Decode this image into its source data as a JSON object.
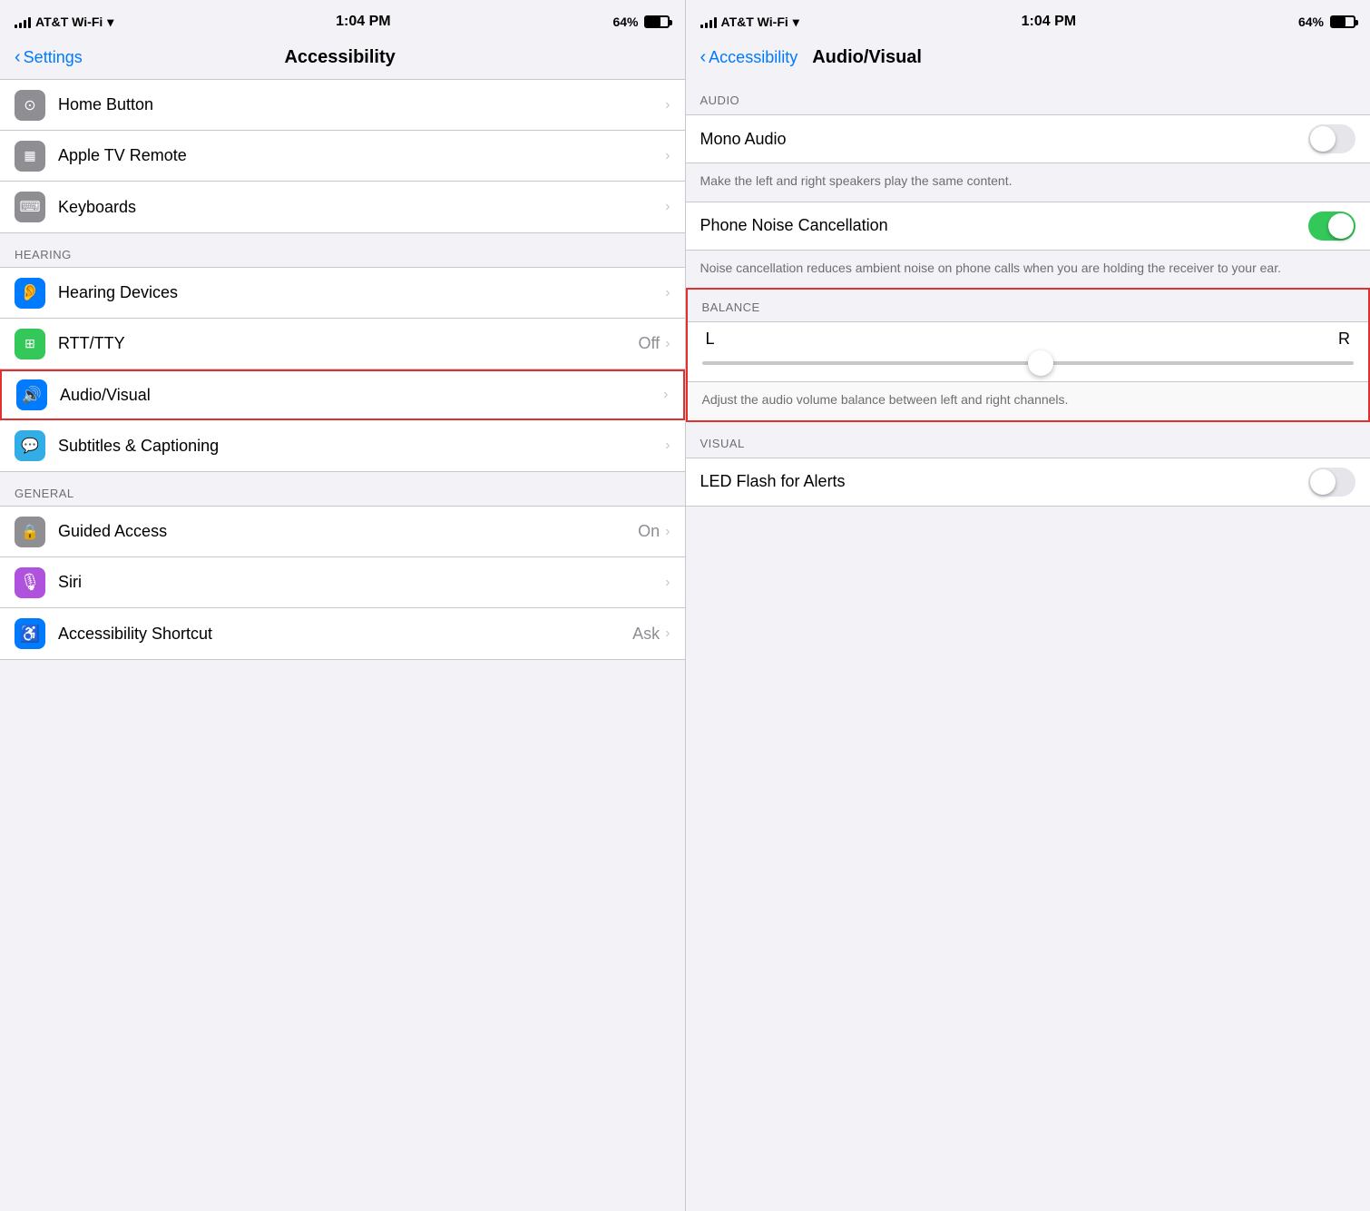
{
  "left_panel": {
    "status": {
      "carrier": "AT&T Wi-Fi",
      "time": "1:04 PM",
      "battery": "64%"
    },
    "nav": {
      "back_label": "Settings",
      "title": "Accessibility"
    },
    "items": [
      {
        "id": "home-button",
        "icon_char": "⊙",
        "icon_class": "icon-gray",
        "label": "Home Button",
        "value": "",
        "has_chevron": true
      },
      {
        "id": "apple-tv-remote",
        "icon_char": "▦",
        "icon_class": "icon-gray",
        "label": "Apple TV Remote",
        "value": "",
        "has_chevron": true
      },
      {
        "id": "keyboards",
        "icon_char": "⌨",
        "icon_class": "icon-gray",
        "label": "Keyboards",
        "value": "",
        "has_chevron": true
      }
    ],
    "hearing_header": "HEARING",
    "hearing_items": [
      {
        "id": "hearing-devices",
        "icon_char": "👂",
        "icon_class": "icon-blue",
        "label": "Hearing Devices",
        "value": "",
        "has_chevron": true
      },
      {
        "id": "rtt-tty",
        "icon_char": "⊞",
        "icon_class": "icon-green",
        "label": "RTT/TTY",
        "value": "Off",
        "has_chevron": true
      },
      {
        "id": "audio-visual",
        "icon_char": "🔊",
        "icon_class": "icon-blue",
        "label": "Audio/Visual",
        "value": "",
        "has_chevron": true,
        "highlighted": true
      },
      {
        "id": "subtitles-captioning",
        "icon_char": "💬",
        "icon_class": "icon-blue2",
        "label": "Subtitles & Captioning",
        "value": "",
        "has_chevron": true
      }
    ],
    "general_header": "GENERAL",
    "general_items": [
      {
        "id": "guided-access",
        "icon_char": "🔒",
        "icon_class": "icon-gray",
        "label": "Guided Access",
        "value": "On",
        "has_chevron": true
      },
      {
        "id": "siri",
        "icon_char": "🎙",
        "icon_class": "icon-purple",
        "label": "Siri",
        "value": "",
        "has_chevron": true
      },
      {
        "id": "accessibility-shortcut",
        "icon_char": "♿",
        "icon_class": "icon-blue",
        "label": "Accessibility Shortcut",
        "value": "Ask",
        "has_chevron": true
      }
    ]
  },
  "right_panel": {
    "status": {
      "carrier": "AT&T Wi-Fi",
      "time": "1:04 PM",
      "battery": "64%"
    },
    "nav": {
      "back_label": "Accessibility",
      "title": "Audio/Visual"
    },
    "audio_header": "AUDIO",
    "mono_audio_label": "Mono Audio",
    "mono_audio_state": "off",
    "mono_audio_desc": "Make the left and right speakers play the same content.",
    "phone_noise_label": "Phone Noise Cancellation",
    "phone_noise_state": "on",
    "phone_noise_desc": "Noise cancellation reduces ambient noise on phone calls when you are holding the receiver to your ear.",
    "balance_header": "BALANCE",
    "balance_l": "L",
    "balance_r": "R",
    "balance_desc": "Adjust the audio volume balance between left and right channels.",
    "visual_header": "VISUAL",
    "led_flash_label": "LED Flash for Alerts",
    "led_flash_state": "off"
  }
}
